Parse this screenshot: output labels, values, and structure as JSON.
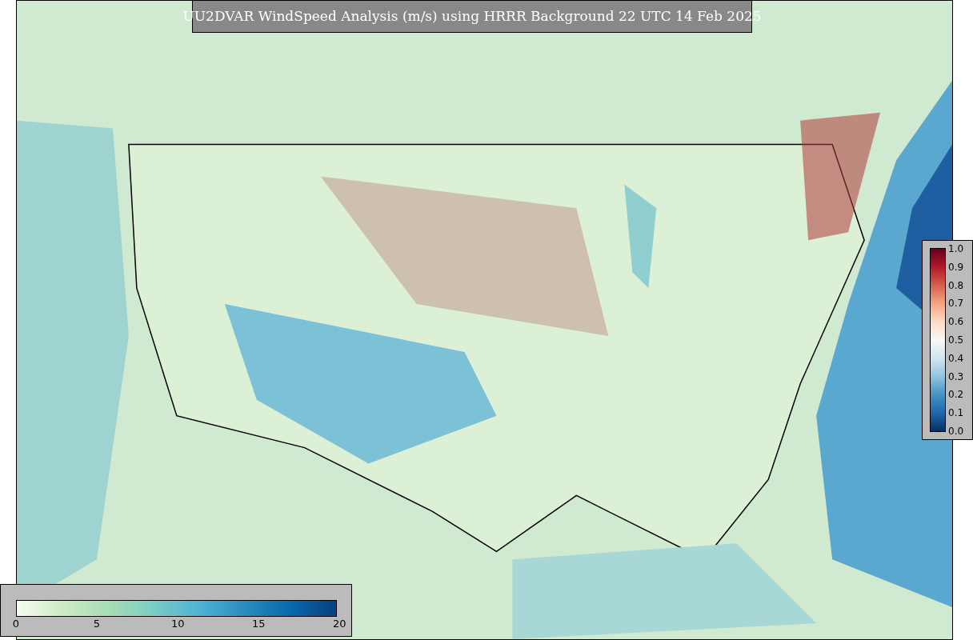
{
  "title": "UU2DVAR WindSpeed Analysis (m/s) using HRRR Background 22 UTC 14 Feb 2025",
  "side_colorbar": {
    "ticks": [
      "1.0",
      "0.9",
      "0.8",
      "0.7",
      "0.6",
      "0.5",
      "0.4",
      "0.3",
      "0.2",
      "0.1",
      "0.0"
    ]
  },
  "bottom_colorbar": {
    "ticks": [
      "0",
      "5",
      "10",
      "15",
      "20"
    ]
  }
}
